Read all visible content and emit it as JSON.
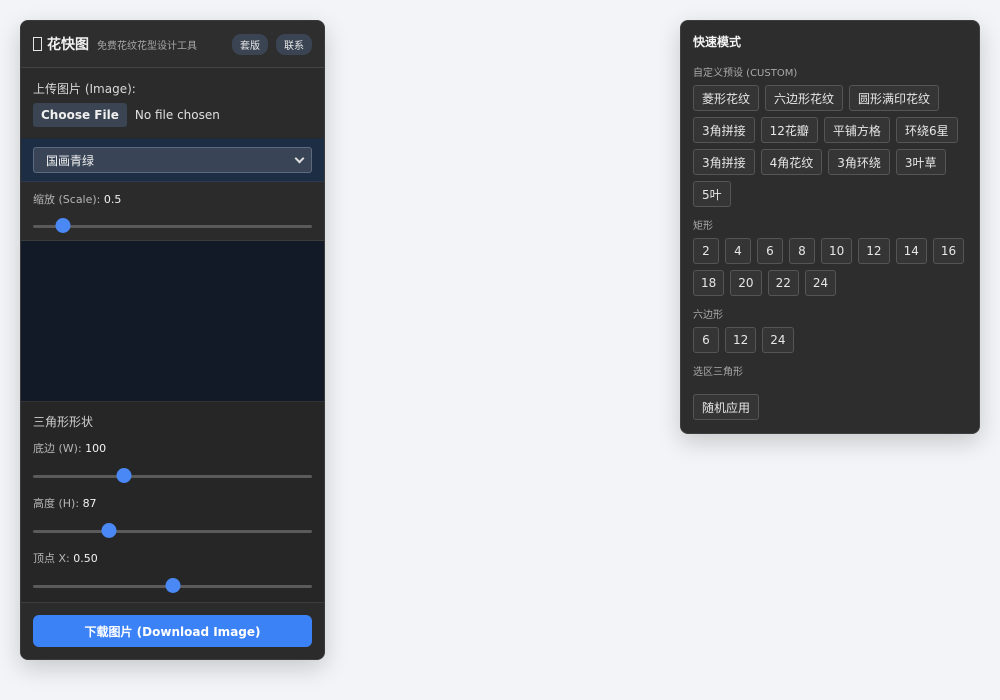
{
  "header": {
    "title": "花快图",
    "subtitle": "免费花纹花型设计工具",
    "buttons": [
      "套版",
      "联系"
    ]
  },
  "upload": {
    "label": "上传图片 (Image):",
    "choose_label": "Choose File",
    "no_file_text": "No file chosen"
  },
  "palette_select": {
    "selected": "国画青绿"
  },
  "scale": {
    "label": "缩放 (Scale):",
    "value": "0.5",
    "fraction": 0.085
  },
  "shape": {
    "title": "三角形形状",
    "params": [
      {
        "label": "底边 (W):",
        "value": "100",
        "fraction": 0.315
      },
      {
        "label": "高度 (H):",
        "value": "87",
        "fraction": 0.26
      },
      {
        "label": "顶点 X:",
        "value": "0.50",
        "fraction": 0.5
      }
    ]
  },
  "download": {
    "label": "下载图片 (Download Image)"
  },
  "quick": {
    "title": "快速模式",
    "custom_label": "自定义预设 (CUSTOM)",
    "custom": [
      "菱形花纹",
      "六边形花纹",
      "圆形满印花纹",
      "3角拼接",
      "12花瓣",
      "平铺方格",
      "环绕6星",
      "3角拼接",
      "4角花纹",
      "3角环绕",
      "3叶草",
      "5叶"
    ],
    "rect_label": "矩形",
    "rect": [
      "2",
      "4",
      "6",
      "8",
      "10",
      "12",
      "14",
      "16",
      "18",
      "20",
      "22",
      "24"
    ],
    "hex_label": "六边形",
    "hex": [
      "6",
      "12",
      "24"
    ],
    "tri_label": "选区三角形",
    "random_label": "随机应用"
  },
  "colors": {
    "accent": "#3b82f6",
    "panel_bg": "#232323",
    "canvas_bg": "#121a28",
    "page_bg": "#f2f4f7"
  }
}
